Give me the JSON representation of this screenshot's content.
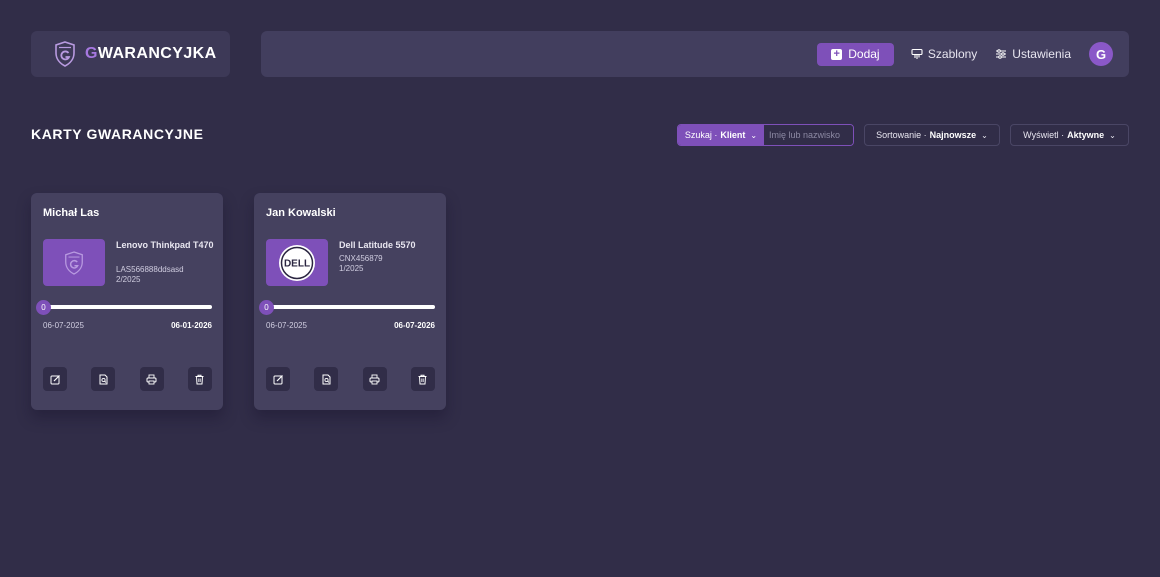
{
  "app": {
    "logo_first_letter": "G",
    "logo_rest": "WARANCYJKA"
  },
  "topbar": {
    "add_label": "Dodaj",
    "templates_label": "Szablony",
    "settings_label": "Ustawienia",
    "avatar_letter": "G"
  },
  "page": {
    "title": "KARTY GWARANCYJNE"
  },
  "filters": {
    "search_prefix": "Szukaj ·",
    "search_field": "Klient",
    "search_placeholder": "Imię lub nazwisko",
    "sort_prefix": "Sortowanie ·",
    "sort_value": "Najnowsze",
    "view_prefix": "Wyświetl ·",
    "view_value": "Aktywne"
  },
  "cards": [
    {
      "client": "Michał Las",
      "device": "Lenovo Thinkpad T470",
      "serial": "LAS566888ddsasd",
      "doc": "2/2025",
      "progress_label": "0",
      "progress": 0,
      "date_start": "06-07-2025",
      "date_end": "06-01-2026",
      "thumb_icon": "gwarancyjka-logo-icon"
    },
    {
      "client": "Jan Kowalski",
      "device": "Dell Latitude 5570",
      "serial": "CNX456879",
      "doc": "1/2025",
      "progress_label": "0",
      "progress": 0,
      "date_start": "06-07-2025",
      "date_end": "06-07-2026",
      "thumb_icon": "dell-logo-icon",
      "thumb_logo_text": "DELL"
    }
  ],
  "colors": {
    "background": "#312d48",
    "accent": "#7e50b9",
    "panel": "#423e5e",
    "card": "#45415f"
  }
}
